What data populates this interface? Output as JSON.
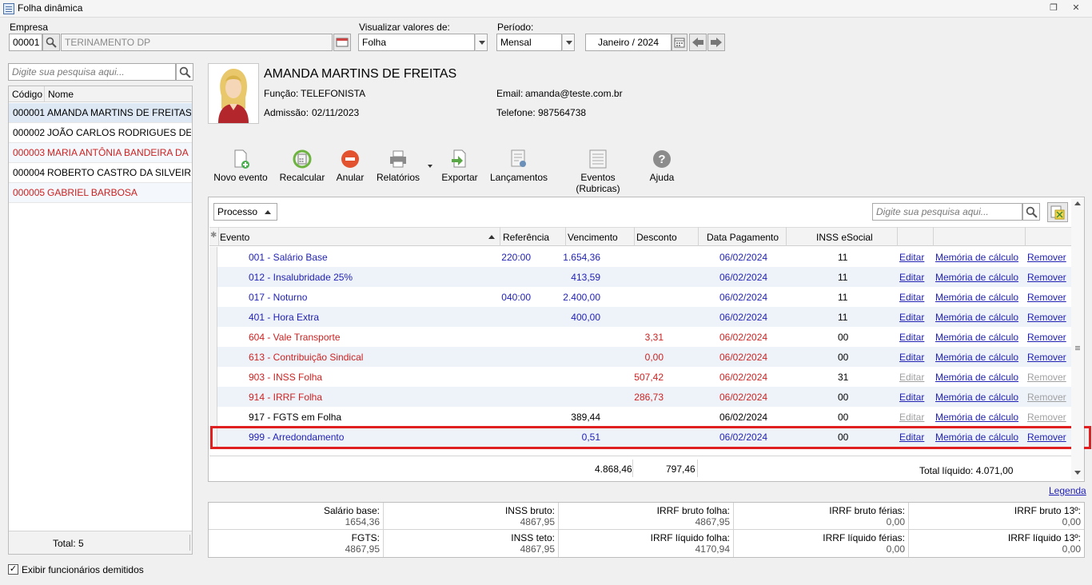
{
  "window": {
    "title": "Folha dinâmica"
  },
  "filters": {
    "empresa_label": "Empresa",
    "empresa_code": "00001",
    "empresa_name": "TERINAMENTO DP",
    "visualizar_label": "Visualizar valores de:",
    "visualizar_value": "Folha",
    "periodo_label": "Período:",
    "periodo_value": "Mensal",
    "periodo_date": "Janeiro / 2024"
  },
  "sidebar": {
    "search_placeholder": "Digite sua pesquisa aqui...",
    "col_codigo": "Código",
    "col_nome": "Nome",
    "employees": [
      {
        "code": "000001",
        "name": "AMANDA MARTINS DE FREITAS",
        "color": "#000000"
      },
      {
        "code": "000002",
        "name": "JOÃO CARLOS RODRIGUES DE",
        "color": "#000000"
      },
      {
        "code": "000003",
        "name": "MARIA ANTÔNIA BANDEIRA DA",
        "color": "#cc2222"
      },
      {
        "code": "000004",
        "name": "ROBERTO CASTRO DA SILVEIRA",
        "color": "#000000"
      },
      {
        "code": "000005",
        "name": "GABRIEL BARBOSA",
        "color": "#cc2222"
      }
    ],
    "total": "Total: 5",
    "show_dismissed": "Exibir funcionários demitidos"
  },
  "employee": {
    "name": "AMANDA MARTINS DE FREITAS",
    "funcao_label": "Função:",
    "funcao": "TELEFONISTA",
    "admissao_label": "Admissão:",
    "admissao": "02/11/2023",
    "email_label": "Email:",
    "email": "amanda@teste.com.br",
    "telefone_label": "Telefone:",
    "telefone": "987564738"
  },
  "toolbar": {
    "novo_evento": "Novo evento",
    "recalcular": "Recalcular",
    "anular": "Anular",
    "relatorios": "Relatórios",
    "exportar": "Exportar",
    "lancamentos": "Lançamentos",
    "eventos": "Eventos (Rubricas)",
    "ajuda": "Ajuda"
  },
  "grid": {
    "group_label": "Processo",
    "search_placeholder": "Digite sua pesquisa aqui...",
    "columns": {
      "evento": "Evento",
      "referencia": "Referência",
      "vencimento": "Vencimento",
      "desconto": "Desconto",
      "data_pagamento": "Data Pagamento",
      "inss": "INSS eSocial"
    },
    "action_editar": "Editar",
    "action_memoria": "Memória de cálculo",
    "action_remover": "Remover",
    "rows": [
      {
        "evento": "001 - Salário Base",
        "ref": "220:00",
        "venc": "1.654,36",
        "desc": "",
        "data": "06/02/2024",
        "inss": "11",
        "color": "#1f1fb4",
        "edit_on": true,
        "rem_on": true
      },
      {
        "evento": "012 - Insalubridade 25%",
        "ref": "",
        "venc": "413,59",
        "desc": "",
        "data": "06/02/2024",
        "inss": "11",
        "color": "#1f1fb4",
        "edit_on": true,
        "rem_on": true
      },
      {
        "evento": "017 - Noturno",
        "ref": "040:00",
        "venc": "2.400,00",
        "desc": "",
        "data": "06/02/2024",
        "inss": "11",
        "color": "#1f1fb4",
        "edit_on": true,
        "rem_on": true
      },
      {
        "evento": "401 - Hora Extra",
        "ref": "",
        "venc": "400,00",
        "desc": "",
        "data": "06/02/2024",
        "inss": "11",
        "color": "#1f1fb4",
        "edit_on": true,
        "rem_on": true
      },
      {
        "evento": "604 - Vale Transporte",
        "ref": "",
        "venc": "",
        "desc": "3,31",
        "data": "06/02/2024",
        "inss": "00",
        "color": "#cc2222",
        "edit_on": true,
        "rem_on": true
      },
      {
        "evento": "613 - Contribuição Sindical",
        "ref": "",
        "venc": "",
        "desc": "0,00",
        "data": "06/02/2024",
        "inss": "00",
        "color": "#cc2222",
        "edit_on": true,
        "rem_on": true
      },
      {
        "evento": "903 - INSS Folha",
        "ref": "",
        "venc": "",
        "desc": "507,42",
        "data": "06/02/2024",
        "inss": "31",
        "color": "#cc2222",
        "edit_on": false,
        "rem_on": false
      },
      {
        "evento": "914 - IRRF Folha",
        "ref": "",
        "venc": "",
        "desc": "286,73",
        "data": "06/02/2024",
        "inss": "00",
        "color": "#cc2222",
        "edit_on": true,
        "rem_on": false
      },
      {
        "evento": "917 - FGTS em Folha",
        "ref": "",
        "venc": "389,44",
        "desc": "",
        "data": "06/02/2024",
        "inss": "00",
        "color": "#000000",
        "edit_on": false,
        "rem_on": false
      },
      {
        "evento": "999 - Arredondamento",
        "ref": "",
        "venc": "0,51",
        "desc": "",
        "data": "06/02/2024",
        "inss": "00",
        "color": "#1f1fb4",
        "edit_on": true,
        "rem_on": true
      }
    ],
    "sum_vencimento": "4.868,46",
    "sum_desconto": "797,46",
    "total_liquido": "Total líquido: 4.071,00",
    "legenda": "Legenda"
  },
  "totals": [
    {
      "label": "Salário base:",
      "value": "1654,36"
    },
    {
      "label": "INSS bruto:",
      "value": "4867,95"
    },
    {
      "label": "IRRF bruto folha:",
      "value": "4867,95"
    },
    {
      "label": "IRRF bruto férias:",
      "value": "0,00"
    },
    {
      "label": "IRRF bruto 13º:",
      "value": "0,00"
    },
    {
      "label": "FGTS:",
      "value": "4867,95"
    },
    {
      "label": "INSS teto:",
      "value": "4867,95"
    },
    {
      "label": "IRRF líquido folha:",
      "value": "4170,94"
    },
    {
      "label": "IRRF líquido férias:",
      "value": "0,00"
    },
    {
      "label": "IRRF líquido 13º:",
      "value": "0,00"
    }
  ]
}
